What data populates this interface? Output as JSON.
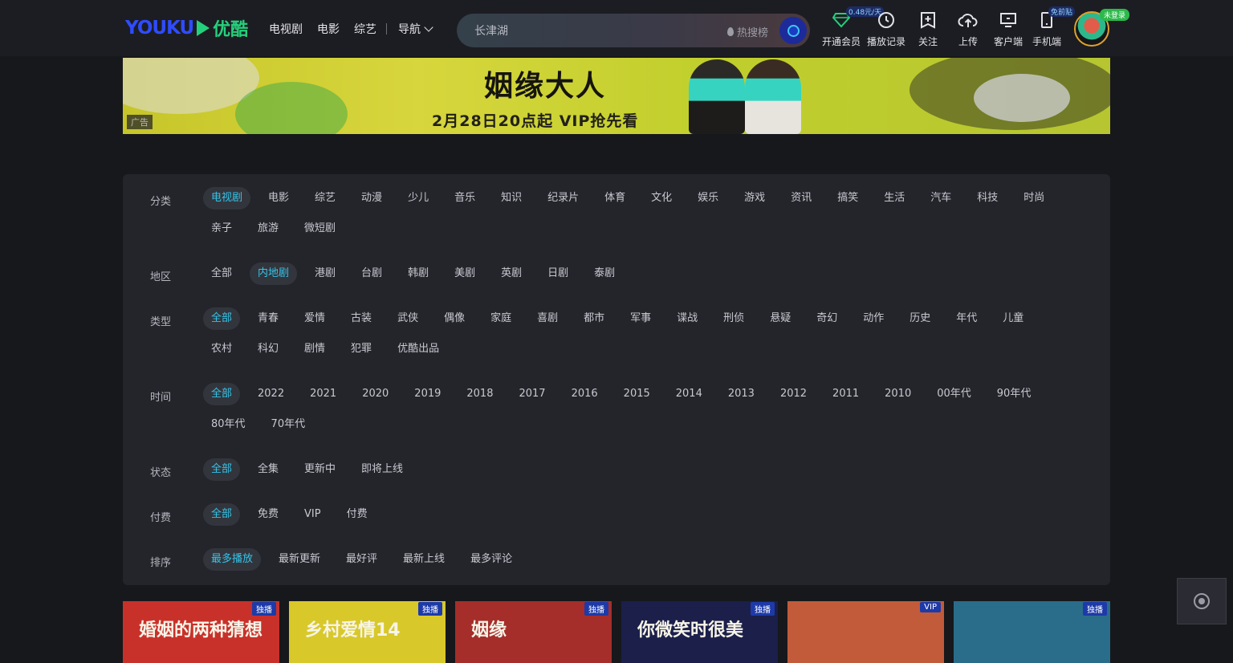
{
  "header": {
    "logo_youku": "YOUKU",
    "logo_cn": "优酷",
    "nav": [
      "电视剧",
      "电影",
      "综艺"
    ],
    "nav_more": "导航",
    "search_placeholder": "长津湖",
    "hot_label": "热搜榜",
    "tools": [
      {
        "icon": "diamond-icon",
        "label": "开通会员",
        "bubble": "0.48元/天"
      },
      {
        "icon": "clock-icon",
        "label": "播放记录",
        "bubble": ""
      },
      {
        "icon": "bookmark-plus-icon",
        "label": "关注",
        "bubble": ""
      },
      {
        "icon": "cloud-upload-icon",
        "label": "上传",
        "bubble": ""
      },
      {
        "icon": "monitor-icon",
        "label": "客户端",
        "bubble": ""
      },
      {
        "icon": "phone-icon",
        "label": "手机端",
        "bubble": "免前贴"
      }
    ],
    "avatar_badge": "未登录"
  },
  "banner": {
    "title": "姻缘大人",
    "subtitle": "2月28日20点起 VIP抢先看",
    "ad_label": "广告"
  },
  "filters": [
    {
      "label": "分类",
      "options": [
        "电视剧",
        "电影",
        "综艺",
        "动漫",
        "少儿",
        "音乐",
        "知识",
        "纪录片",
        "体育",
        "文化",
        "娱乐",
        "游戏",
        "资讯",
        "搞笑",
        "生活",
        "汽车",
        "科技",
        "时尚",
        "亲子",
        "旅游",
        "微短剧"
      ],
      "active": 0
    },
    {
      "label": "地区",
      "options": [
        "全部",
        "内地剧",
        "港剧",
        "台剧",
        "韩剧",
        "美剧",
        "英剧",
        "日剧",
        "泰剧"
      ],
      "active": 1
    },
    {
      "label": "类型",
      "options": [
        "全部",
        "青春",
        "爱情",
        "古装",
        "武侠",
        "偶像",
        "家庭",
        "喜剧",
        "都市",
        "军事",
        "谍战",
        "刑侦",
        "悬疑",
        "奇幻",
        "动作",
        "历史",
        "年代",
        "儿童",
        "农村",
        "科幻",
        "剧情",
        "犯罪",
        "优酷出品"
      ],
      "active": 0
    },
    {
      "label": "时间",
      "options": [
        "全部",
        "2022",
        "2021",
        "2020",
        "2019",
        "2018",
        "2017",
        "2016",
        "2015",
        "2014",
        "2013",
        "2012",
        "2011",
        "2010",
        "00年代",
        "90年代",
        "80年代",
        "70年代"
      ],
      "active": 0
    },
    {
      "label": "状态",
      "options": [
        "全部",
        "全集",
        "更新中",
        "即将上线"
      ],
      "active": 0
    },
    {
      "label": "付费",
      "options": [
        "全部",
        "免费",
        "VIP",
        "付费"
      ],
      "active": 0
    },
    {
      "label": "排序",
      "options": [
        "最多播放",
        "最新更新",
        "最好评",
        "最新上线",
        "最多评论"
      ],
      "active": 0
    }
  ],
  "cards": [
    {
      "tag": "独播",
      "title": "婚姻的两种猜想",
      "bg": "#c8312a"
    },
    {
      "tag": "独播",
      "title": "乡村爱情14",
      "bg": "#d8c82a"
    },
    {
      "tag": "独播",
      "title": "姻缘",
      "bg": "#a52e2a"
    },
    {
      "tag": "独播",
      "title": "你微笑时很美",
      "bg": "#1b1f4a"
    },
    {
      "tag": "VIP",
      "title": "",
      "bg": "#c25b3a"
    },
    {
      "tag": "独播",
      "title": "",
      "bg": "#2a6d8a"
    }
  ],
  "colors": {
    "accent": "#34c4e8",
    "brand_green": "#25d07c",
    "brand_blue": "#2f4cff"
  }
}
